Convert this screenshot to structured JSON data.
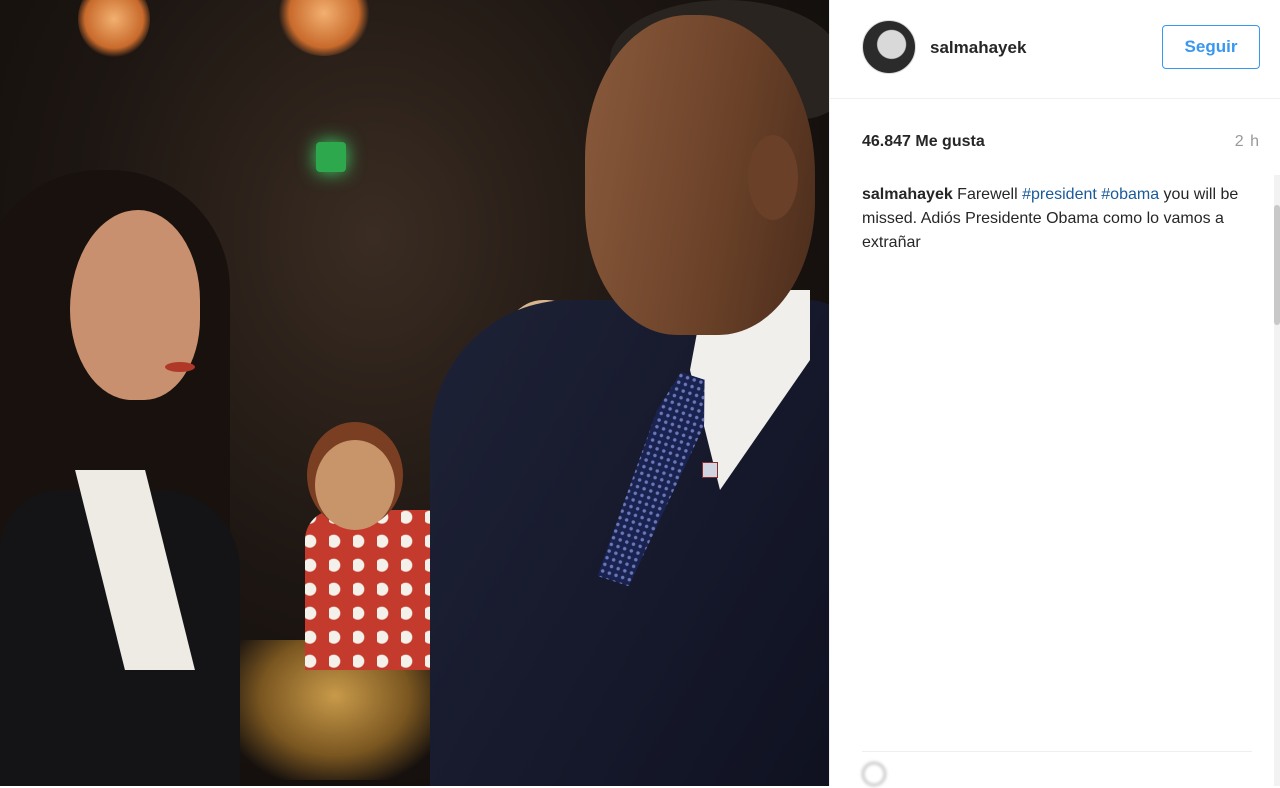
{
  "post": {
    "username": "salmahayek",
    "follow_label": "Seguir",
    "likes": "46.847 Me gusta",
    "time_ago": "2 h",
    "caption": {
      "user": "salmahayek",
      "text_1": " Farewell ",
      "tag_1": "#president",
      "text_2": " ",
      "tag_2": "#obama",
      "text_3": " you will be missed. Adiós Presidente Obama como lo vamos a extrañar"
    }
  }
}
